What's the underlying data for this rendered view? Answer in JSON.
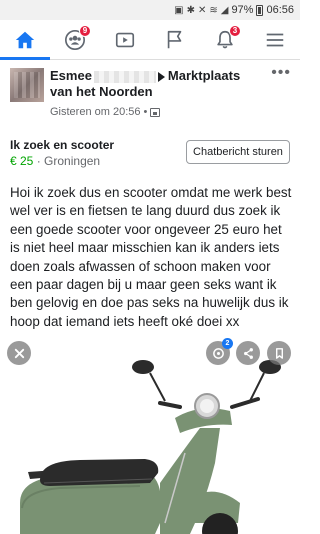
{
  "status_bar": {
    "battery": "97%",
    "time": "06:56",
    "icons": [
      "sim-icon",
      "bluetooth-icon",
      "mute-icon",
      "wifi-icon",
      "signal-icon",
      "battery-icon"
    ]
  },
  "tabs": [
    {
      "name": "home",
      "icon": "home-icon",
      "active": true,
      "badge": ""
    },
    {
      "name": "groups",
      "icon": "groups-icon",
      "active": false,
      "badge": "9"
    },
    {
      "name": "watch",
      "icon": "video-icon",
      "active": false,
      "badge": ""
    },
    {
      "name": "pages",
      "icon": "flag-icon",
      "active": false,
      "badge": ""
    },
    {
      "name": "notifications",
      "icon": "bell-icon",
      "active": false,
      "badge": "3"
    },
    {
      "name": "menu",
      "icon": "hamburger-icon",
      "active": false,
      "badge": ""
    }
  ],
  "post": {
    "author_first": "Esmee",
    "group": "Marktplaats van het Noorden",
    "timestamp": "Gisteren om 20:56",
    "separator": "•",
    "more": "•••"
  },
  "listing": {
    "title": "Ik zoek en scooter",
    "price": "€ 25",
    "location_sep": "·",
    "location": "Groningen",
    "chat_button": "Chatbericht sturen"
  },
  "body_text": "Hoi ik zoek dus en scooter omdat me werk best wel ver is en fietsen te lang duurd dus zoek ik een goede scooter voor ongeveer 25 euro het is niet heel maar misschien kan ik anders iets doen zoals afwassen of schoon maken voor een paar dagen bij u maar geen seks want ik ben gelovig en doe pas seks na huwelijk dus ik hoop dat iemand iets heeft oké doei xx",
  "photo": {
    "tag_count": "2",
    "colors": {
      "scooter_body": "#7a9273",
      "seat": "#2b2b2b",
      "chrome": "#c9c9c9"
    }
  },
  "colors": {
    "accent": "#1877f2",
    "badge": "#e41e3f",
    "price": "#00a400"
  }
}
